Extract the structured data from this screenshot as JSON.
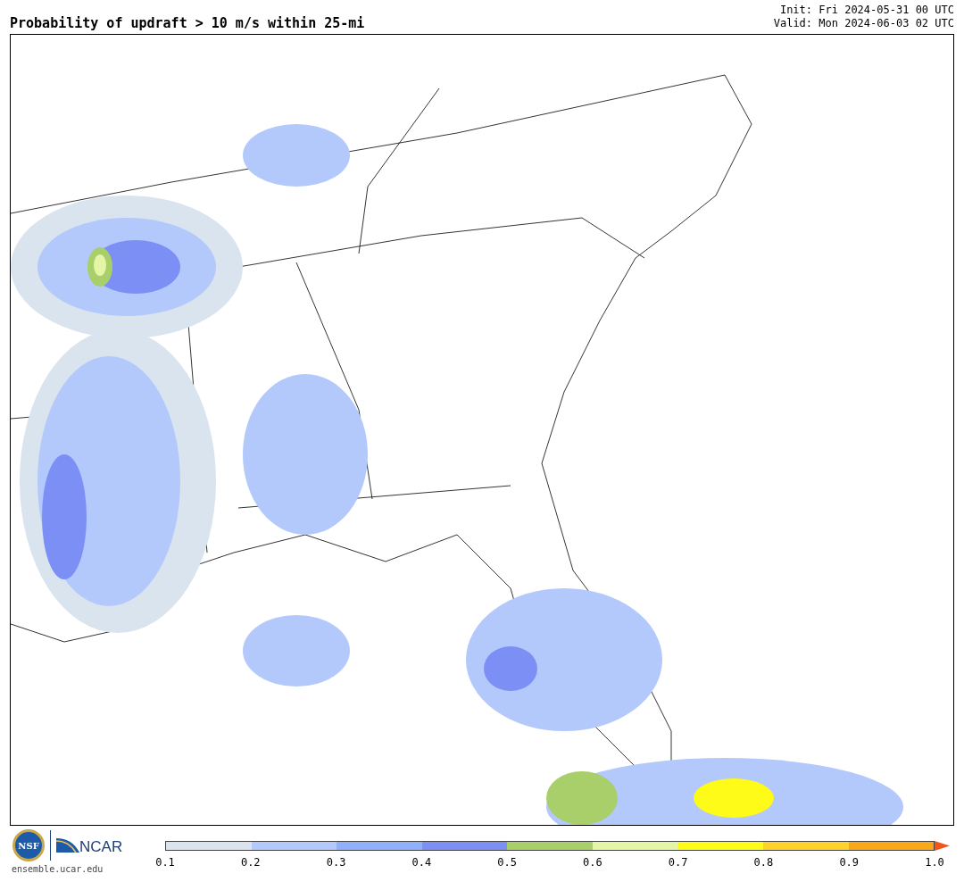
{
  "title": "Probability of updraft > 10 m/s within 25-mi",
  "init": "Init: Fri 2024-05-31 00 UTC",
  "valid": "Valid: Mon 2024-06-03 02 UTC",
  "logos": {
    "nsf": "NSF",
    "ncar": "NCAR",
    "site": "ensemble.ucar.edu"
  },
  "colorbar": {
    "bins": [
      {
        "color": "#d9e4ef"
      },
      {
        "color": "#b3c8fb"
      },
      {
        "color": "#8fb0fa"
      },
      {
        "color": "#7b8ff5"
      },
      {
        "color": "#a9cf6a"
      },
      {
        "color": "#e4f5a6"
      },
      {
        "color": "#fefb19"
      },
      {
        "color": "#fed22a"
      },
      {
        "color": "#fba71a"
      }
    ],
    "extend": {
      "color": "#f0551a"
    },
    "ticks": [
      "0.1",
      "0.2",
      "0.3",
      "0.4",
      "0.5",
      "0.6",
      "0.7",
      "0.8",
      "0.9",
      "1.0"
    ]
  }
}
